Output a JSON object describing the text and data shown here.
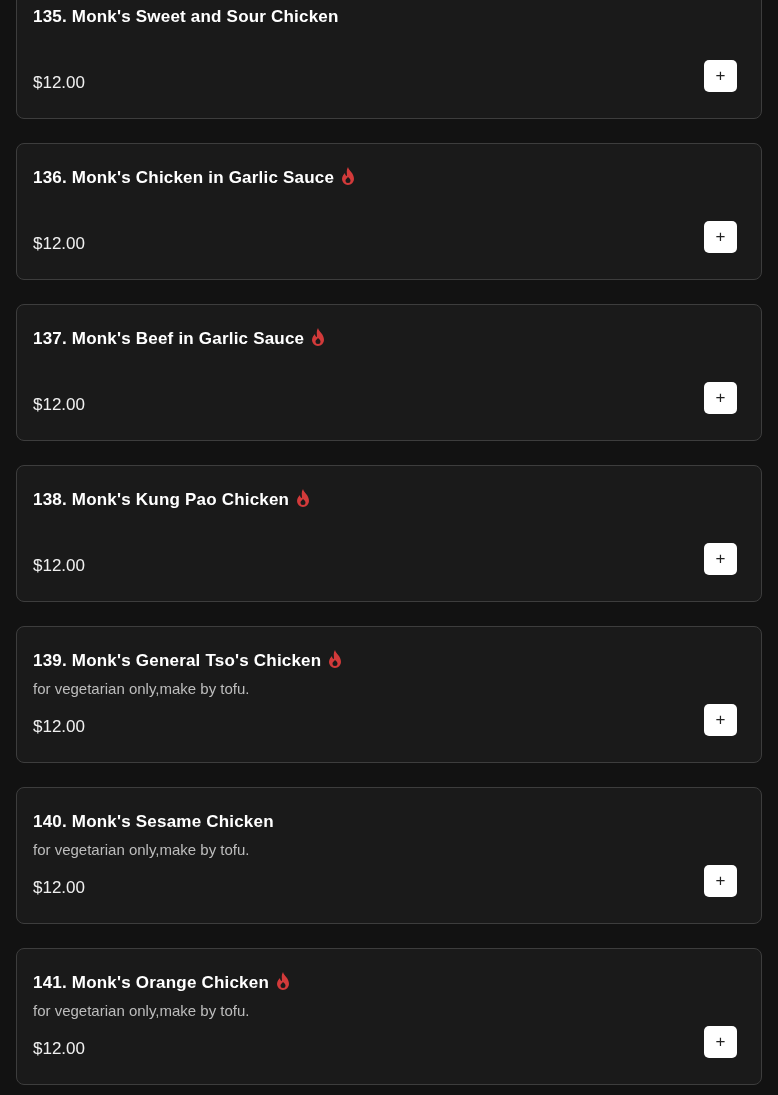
{
  "menu_items": [
    {
      "title": "135. Monk's Sweet and Sour Chicken",
      "spicy": false,
      "price": "$12.00",
      "add_button": "+"
    },
    {
      "title": "136. Monk's Chicken in Garlic Sauce",
      "spicy": true,
      "price": "$12.00",
      "add_button": "+"
    },
    {
      "title": "137. Monk's Beef in Garlic Sauce",
      "spicy": true,
      "price": "$12.00",
      "add_button": "+"
    },
    {
      "title": "138. Monk's Kung Pao Chicken",
      "spicy": true,
      "price": "$12.00",
      "add_button": "+"
    },
    {
      "title": "139. Monk's General Tso's Chicken",
      "spicy": true,
      "description": "for vegetarian only,make by tofu.",
      "price": "$12.00",
      "add_button": "+"
    },
    {
      "title": "140. Monk's Sesame Chicken",
      "spicy": false,
      "description": "for vegetarian only,make by tofu.",
      "price": "$12.00",
      "add_button": "+"
    },
    {
      "title": "141. Monk's Orange Chicken",
      "spicy": true,
      "description": "for vegetarian only,make by tofu.",
      "price": "$12.00",
      "add_button": "+"
    }
  ]
}
